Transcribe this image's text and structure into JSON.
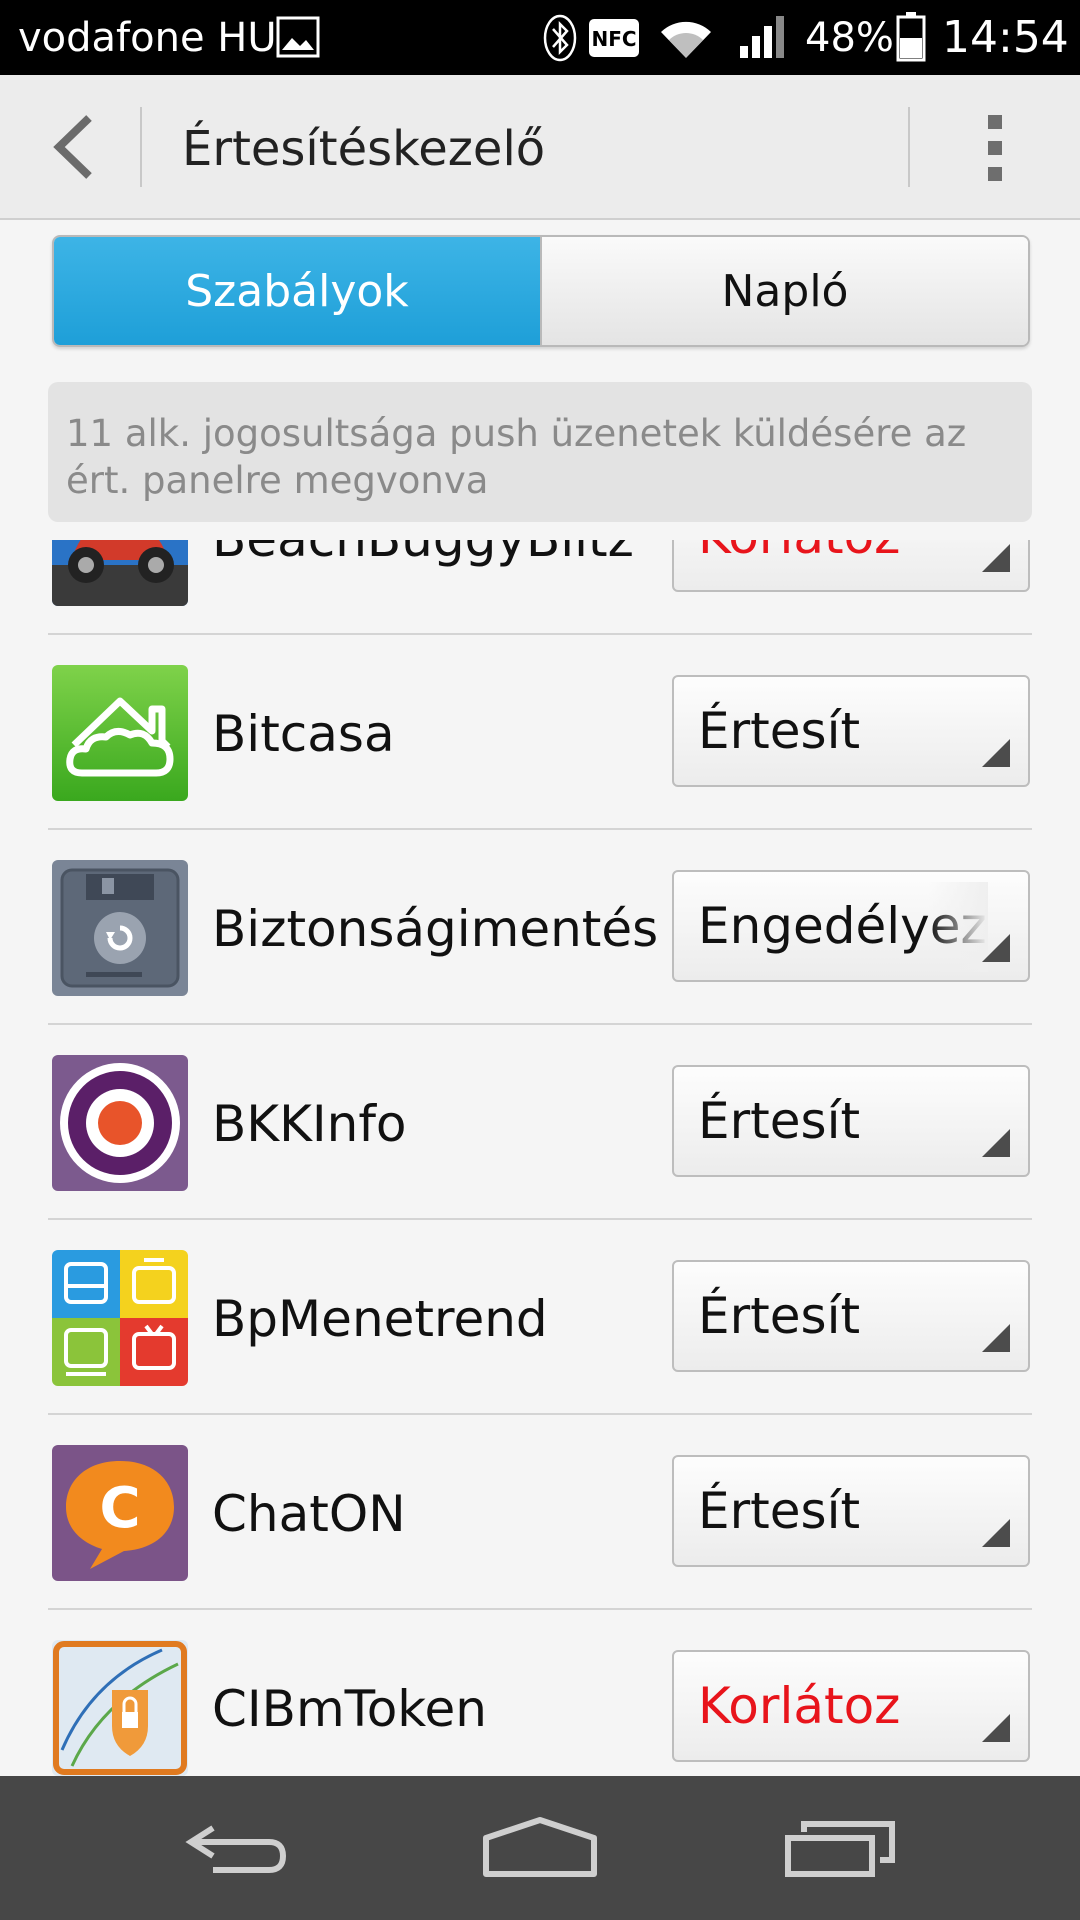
{
  "status_bar": {
    "carrier": "vodafone HU",
    "battery_percent": "48%",
    "time": "14:54",
    "icons": [
      "image-icon",
      "bluetooth-icon",
      "nfc-icon",
      "wifi-icon",
      "signal-icon",
      "battery-icon"
    ],
    "nfc_label": "NFC"
  },
  "action_bar": {
    "title": "Értesítéskezelő"
  },
  "tabs": [
    {
      "label": "Szabályok",
      "active": true
    },
    {
      "label": "Napló",
      "active": false
    }
  ],
  "info": {
    "text": "11 alk. jogosultsága push üzenetek küldésére az ért. panelre megvonva"
  },
  "colors": {
    "accent": "#1e9fd8",
    "restricted": "#e8141b",
    "normal": "#111111"
  },
  "apps": [
    {
      "name": "BeachBuggyBlitz",
      "setting": "Korlátoz",
      "restricted": true
    },
    {
      "name": "Bitcasa",
      "setting": "Értesít",
      "restricted": false
    },
    {
      "name": "Biztonságimentés",
      "setting": "Engedélyez",
      "restricted": false
    },
    {
      "name": "BKKInfo",
      "setting": "Értesít",
      "restricted": false
    },
    {
      "name": "BpMenetrend",
      "setting": "Értesít",
      "restricted": false
    },
    {
      "name": "ChatON",
      "setting": "Értesít",
      "restricted": false
    },
    {
      "name": "CIBmToken",
      "setting": "Korlátoz",
      "restricted": true
    }
  ]
}
